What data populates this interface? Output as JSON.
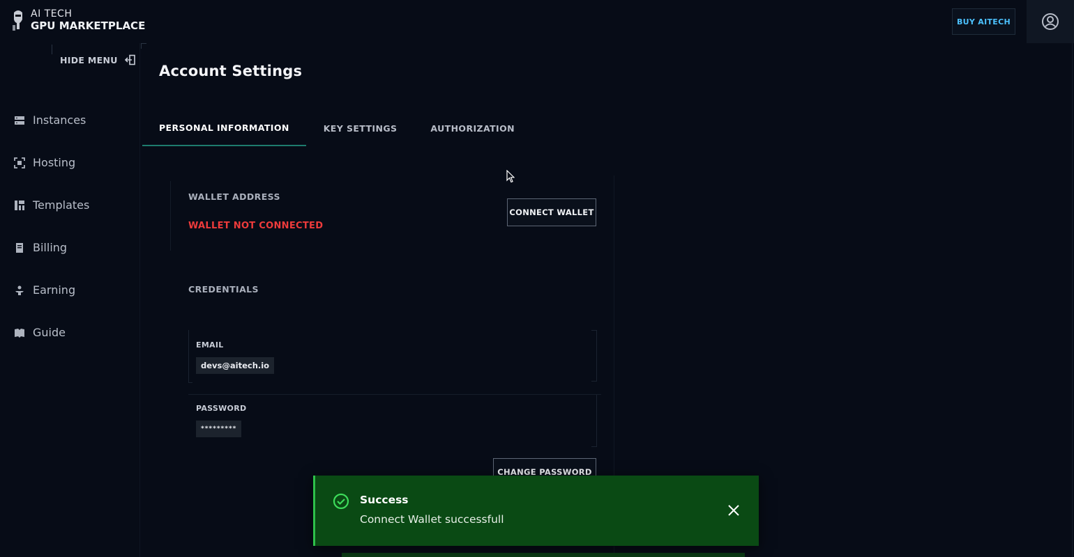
{
  "brand": {
    "line1": "AI TECH",
    "line2": "GPU MARKETPLACE"
  },
  "header": {
    "buy_label": "BUY AITECH"
  },
  "sidebar": {
    "hide_menu_label": "HIDE MENU",
    "items": [
      {
        "label": "Instances",
        "icon": "server-icon"
      },
      {
        "label": "Hosting",
        "icon": "hosting-icon"
      },
      {
        "label": "Templates",
        "icon": "templates-icon"
      },
      {
        "label": "Billing",
        "icon": "billing-icon"
      },
      {
        "label": "Earning",
        "icon": "earning-icon"
      },
      {
        "label": "Guide",
        "icon": "guide-icon"
      }
    ]
  },
  "main": {
    "title": "Account Settings",
    "tabs": [
      {
        "label": "PERSONAL INFORMATION",
        "active": true
      },
      {
        "label": "KEY SETTINGS",
        "active": false
      },
      {
        "label": "AUTHORIZATION",
        "active": false
      }
    ],
    "wallet": {
      "label": "WALLET ADDRESS",
      "status": "WALLET NOT CONNECTED",
      "connect_label": "CONNECT WALLET"
    },
    "credentials": {
      "label": "CREDENTIALS",
      "email_label": "EMAIL",
      "email_value": "devs@aitech.io",
      "password_label": "PASSWORD",
      "password_value": "*********",
      "change_password_label": "CHANGE PASSWORD"
    }
  },
  "toast": {
    "title": "Success",
    "message": "Connect Wallet successfull"
  },
  "colors": {
    "background": "#070c17",
    "accent": "#4cc2ff",
    "error": "#ee3b3b",
    "success_bg": "#0a4a14",
    "success_accent": "#2ec14a",
    "tab_underline": "#1e7c6e"
  }
}
